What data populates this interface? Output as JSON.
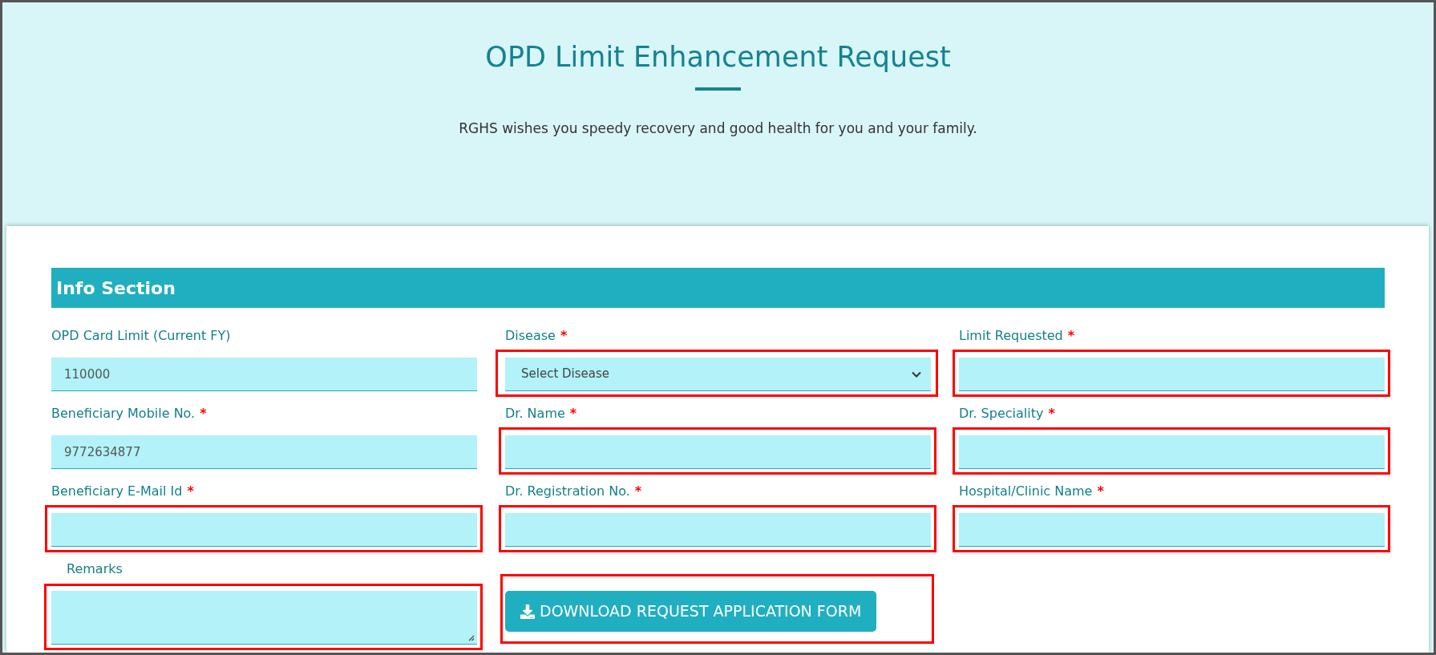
{
  "header": {
    "title": "OPD Limit Enhancement Request",
    "subtitle": "RGHS wishes you speedy recovery and good health for you and your family."
  },
  "section": {
    "title": "Info Section"
  },
  "fields": [
    {
      "kind": "input",
      "label": "OPD Card Limit (Current FY)",
      "value": "110000",
      "highlighted": false
    },
    {
      "kind": "select",
      "label": "Disease",
      "required_mark": "*",
      "placeholder": "Select Disease",
      "highlighted": true
    },
    {
      "kind": "input",
      "label": "Limit Requested",
      "required_mark": "*",
      "highlighted": true
    },
    {
      "kind": "input",
      "label": "Beneficiary Mobile No.",
      "required_mark": "*",
      "value": "9772634877",
      "highlighted": false
    },
    {
      "kind": "input",
      "label": "Dr. Name",
      "required_mark": "*",
      "highlighted": true
    },
    {
      "kind": "input",
      "label": "Dr. Speciality",
      "required_mark": "*",
      "highlighted": true
    },
    {
      "kind": "input",
      "label": "Beneficiary E-Mail Id",
      "required_mark": "*",
      "highlighted": true
    },
    {
      "kind": "input",
      "label": "Dr. Registration No.",
      "required_mark": "*",
      "highlighted": true
    },
    {
      "kind": "input",
      "label": "Hospital/Clinic Name",
      "required_mark": "*",
      "highlighted": true
    },
    {
      "kind": "textarea",
      "label": "Remarks",
      "highlighted": true
    },
    {
      "kind": "button",
      "label": "DOWNLOAD REQUEST APPLICATION FORM",
      "highlighted": true
    }
  ]
}
